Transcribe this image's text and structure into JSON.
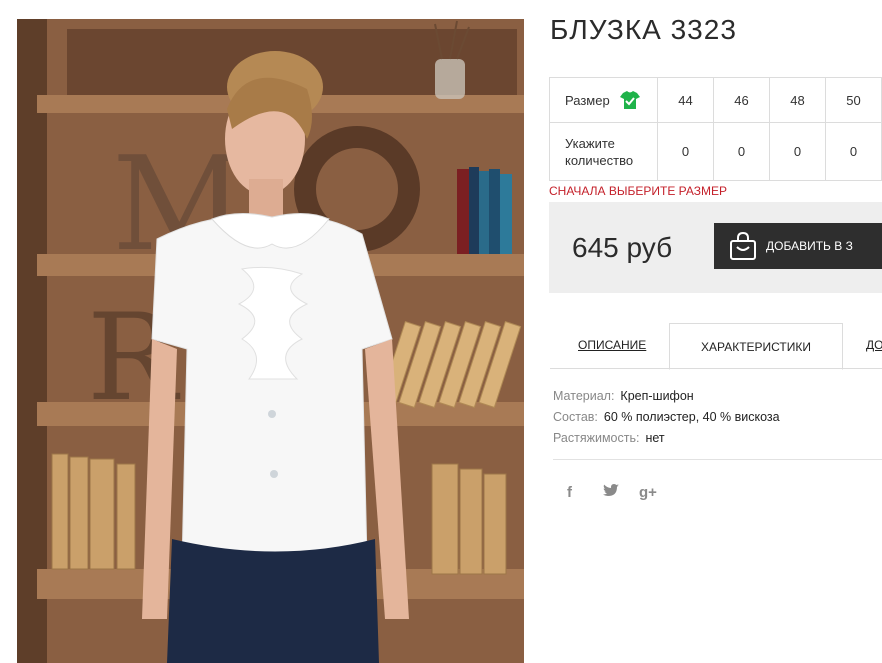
{
  "product": {
    "title": "БЛУЗКА 3323"
  },
  "sizes": {
    "row_label": "Размер",
    "qty_label": "Укажите количество",
    "values": [
      "44",
      "46",
      "48",
      "50"
    ],
    "quantities": [
      "0",
      "0",
      "0",
      "0"
    ],
    "icon": "shirt-check-icon",
    "icon_color": "#1fb34a"
  },
  "warning": "СНАЧАЛА ВЫБЕРИТЕ РАЗМЕР",
  "purchase": {
    "price": "645 руб",
    "add_label": "ДОБАВИТЬ В З"
  },
  "tabs": [
    {
      "label": "ОПИСАНИЕ"
    },
    {
      "label": "ХАРАКТЕРИСТИКИ",
      "active": true
    },
    {
      "label": "ДО"
    }
  ],
  "specs": [
    {
      "key": "Материал:",
      "value": "Креп-шифон"
    },
    {
      "key": "Состав:",
      "value": "60 % полиэстер, 40 % вискоза"
    },
    {
      "key": "Растяжимость:",
      "value": "нет"
    }
  ],
  "social": [
    {
      "glyph": "f",
      "icon": "facebook-icon"
    },
    {
      "glyph": "t",
      "icon": "twitter-icon"
    },
    {
      "glyph": "g+",
      "icon": "google-plus-icon"
    }
  ],
  "colors": {
    "warning": "#c4202a",
    "button": "#2e2e2e",
    "buy_box": "#eeeeee"
  }
}
